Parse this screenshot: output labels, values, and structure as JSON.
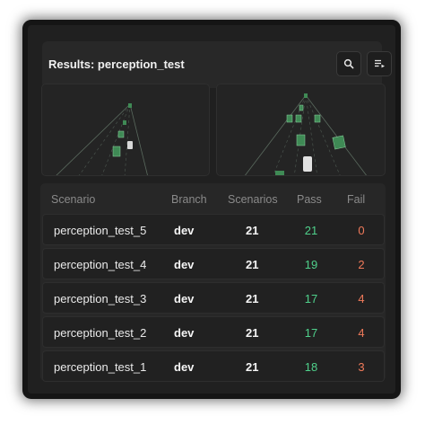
{
  "header": {
    "title": "Results: perception_test",
    "search_icon": "search-icon",
    "sort_icon": "playlist-sort-icon"
  },
  "columns": {
    "scenario": "Scenario",
    "branch": "Branch",
    "scenarios": "Scenarios",
    "pass": "Pass",
    "fail": "Fail"
  },
  "rows": [
    {
      "scenario": "perception_test_5",
      "branch": "dev",
      "scenarios": "21",
      "pass": "21",
      "fail": "0"
    },
    {
      "scenario": "perception_test_4",
      "branch": "dev",
      "scenarios": "21",
      "pass": "19",
      "fail": "2"
    },
    {
      "scenario": "perception_test_3",
      "branch": "dev",
      "scenarios": "21",
      "pass": "17",
      "fail": "4"
    },
    {
      "scenario": "perception_test_2",
      "branch": "dev",
      "scenarios": "21",
      "pass": "17",
      "fail": "4"
    },
    {
      "scenario": "perception_test_1",
      "branch": "dev",
      "scenarios": "21",
      "pass": "18",
      "fail": "3"
    }
  ],
  "colors": {
    "panel": "#202020",
    "pass": "#4fd08b",
    "fail": "#f07a5a",
    "vehicle": "#3f8a55"
  }
}
